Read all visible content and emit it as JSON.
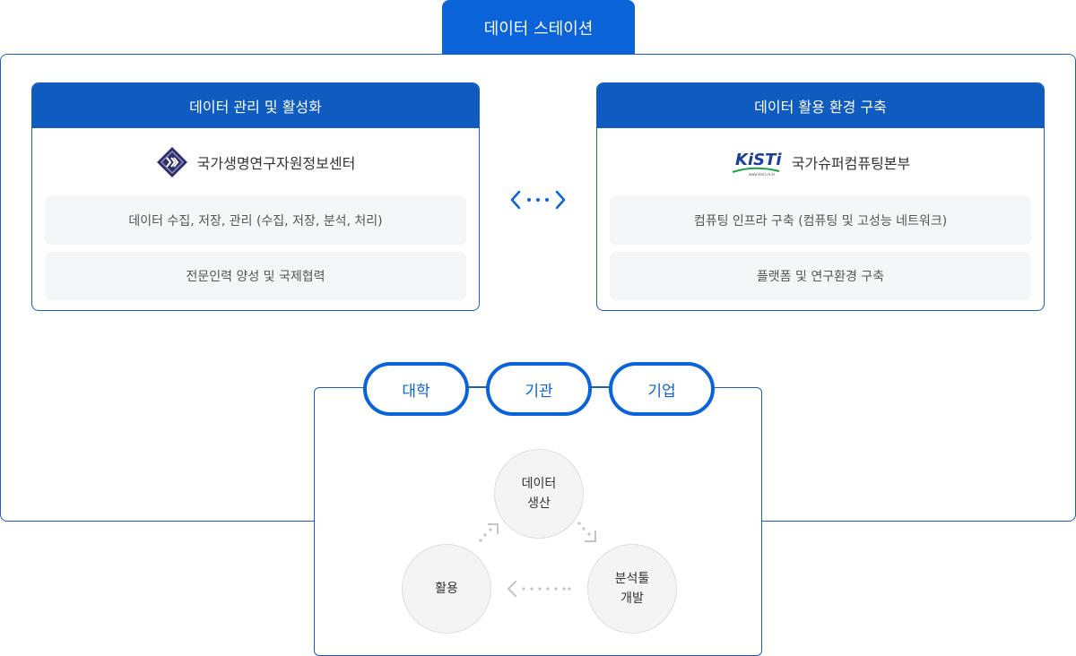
{
  "header": {
    "tab_title": "데이터 스테이션"
  },
  "left_card": {
    "title": "데이터 관리 및 활성화",
    "org_name": "국가생명연구자원정보센터",
    "org_logo_icon": "kobic-logo-icon",
    "items": [
      "데이터 수집, 저장, 관리 (수집, 저장, 분석, 처리)",
      "전문인력 양성 및 국제협력"
    ]
  },
  "right_card": {
    "title": "데이터 활용 환경 구축",
    "org_name": "국가슈퍼컴퓨팅본부",
    "org_logo_icon": "kisti-logo-icon",
    "logo_text": "KiSTi",
    "logo_subtext": "www.kisti.re.kr",
    "items": [
      "컴퓨팅 인프라 구축 (컴퓨팅 및 고성능 네트워크)",
      "플랫폼 및 연구환경 구축"
    ]
  },
  "connector_icon": "bidirectional-dotted-arrow-icon",
  "participants": [
    "대학",
    "기관",
    "기업"
  ],
  "cycle": {
    "produce": [
      "데이터",
      "생산"
    ],
    "tool": [
      "분석툴",
      "개발"
    ],
    "utilize": [
      "활용"
    ]
  },
  "colors": {
    "primary": "#0b63d9",
    "header_blue": "#0f5bbf",
    "border_blue": "#1a5fbf",
    "pill_bg": "#f5f6f8",
    "circle_bg": "#f4f4f4",
    "arrow_gray": "#c4c4c4"
  }
}
